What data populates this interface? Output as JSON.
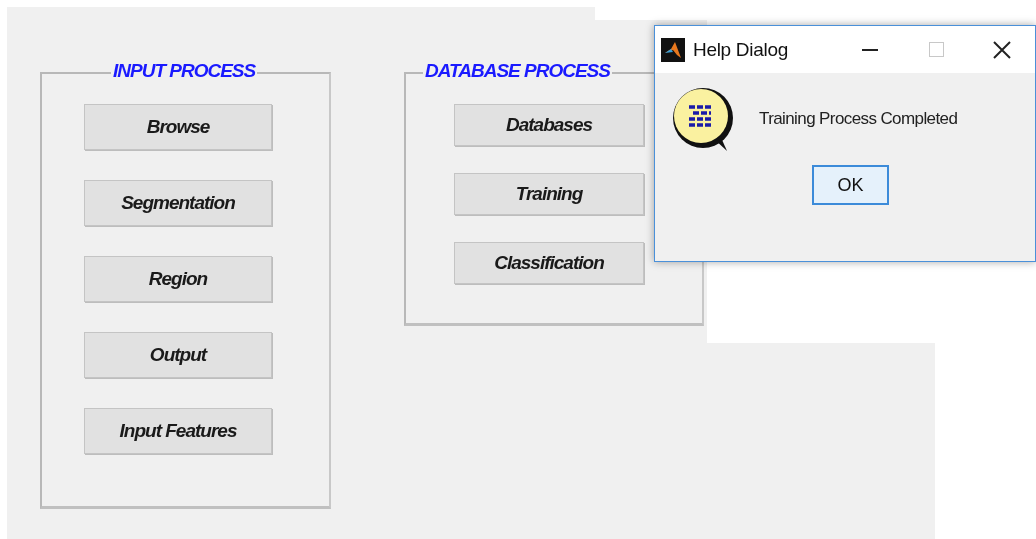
{
  "input_panel": {
    "title": "INPUT PROCESS",
    "buttons": [
      "Browse",
      "Segmentation",
      "Region",
      "Output",
      "Input Features"
    ]
  },
  "database_panel": {
    "title": "DATABASE PROCESS",
    "buttons": [
      "Databases",
      "Training",
      "Classification"
    ]
  },
  "help_dialog": {
    "title": "Help Dialog",
    "message": "Training Process Completed",
    "button": "OK"
  }
}
